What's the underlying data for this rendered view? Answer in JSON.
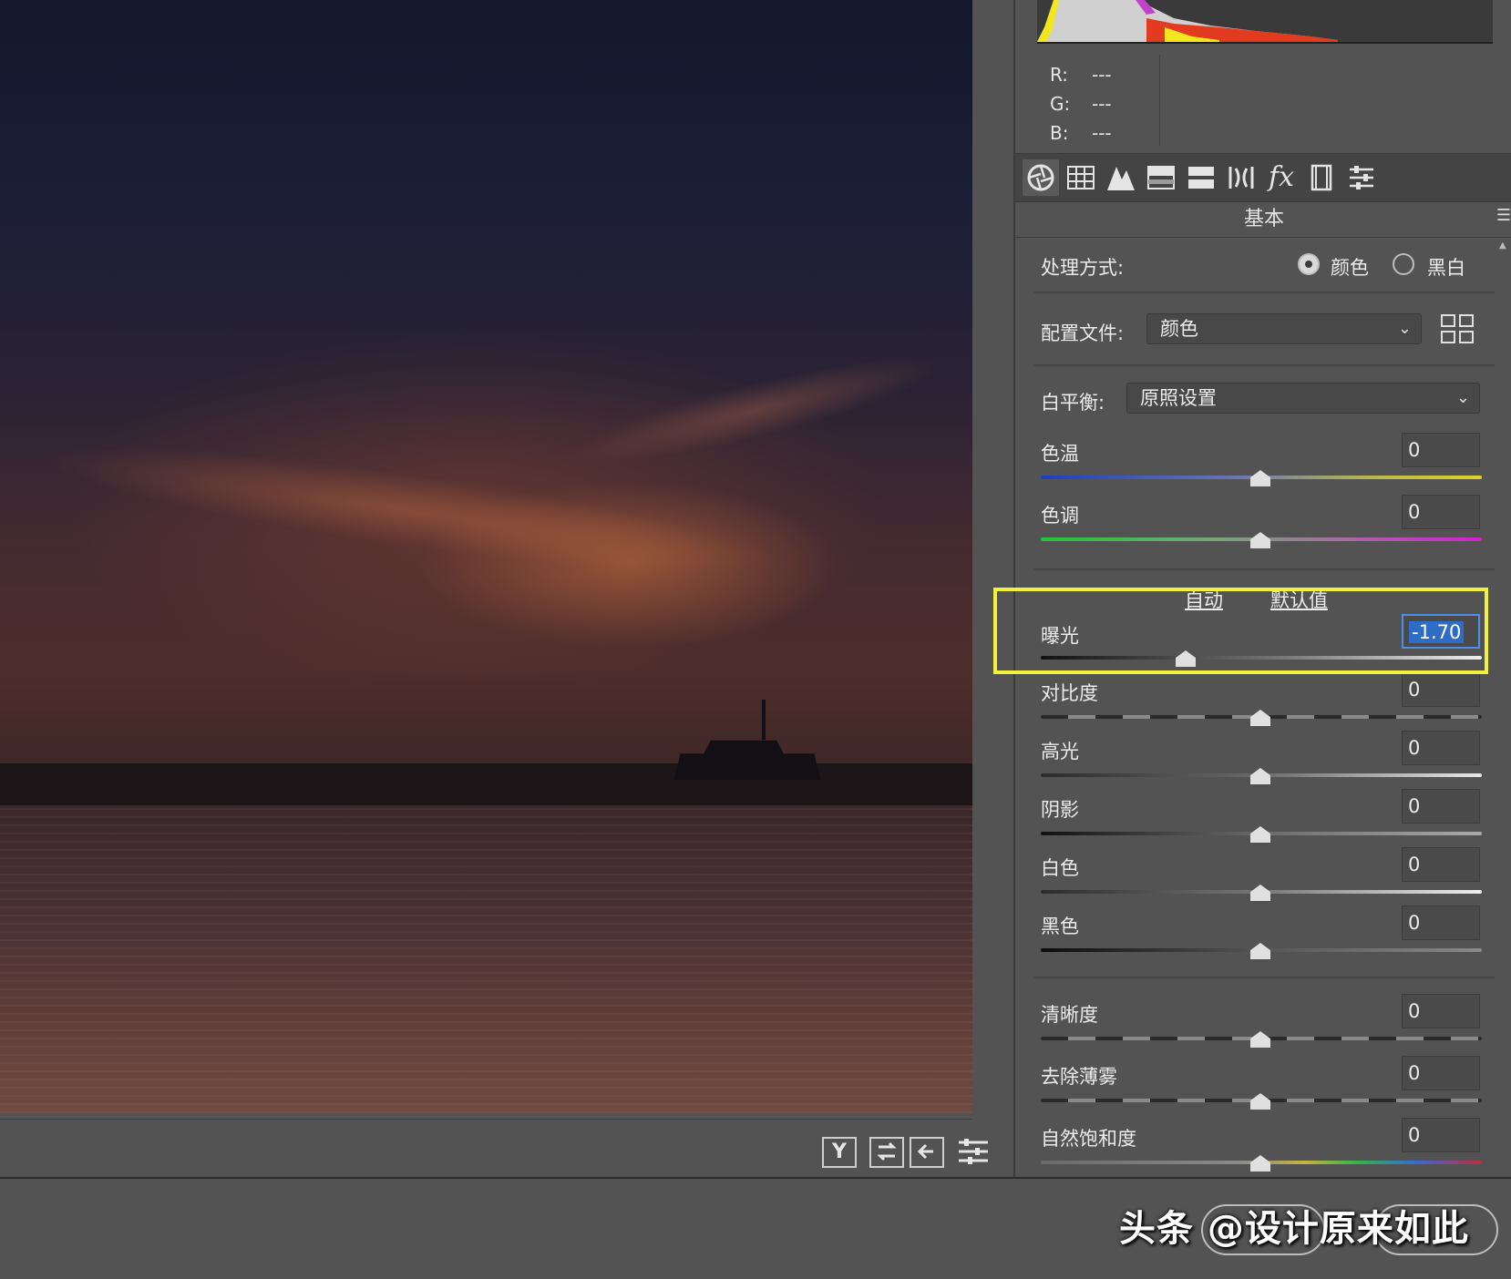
{
  "readout": {
    "r_label": "R:",
    "r_value": "---",
    "g_label": "G:",
    "g_value": "---",
    "b_label": "B:",
    "b_value": "---"
  },
  "tabs": {
    "fx_label": "fx"
  },
  "section_title": "基本",
  "treatment": {
    "label": "处理方式:",
    "color_option": "颜色",
    "bw_option": "黑白",
    "selected": "颜色"
  },
  "profile": {
    "label": "配置文件:",
    "value": "颜色"
  },
  "white_balance": {
    "label": "白平衡:",
    "value": "原照设置"
  },
  "sliders_wb": [
    {
      "label": "色温",
      "value": "0"
    },
    {
      "label": "色调",
      "value": "0"
    }
  ],
  "auto_label": "自动",
  "default_label": "默认值",
  "exposure": {
    "label": "曝光",
    "value": "-1.70"
  },
  "sliders_tone": [
    {
      "label": "对比度",
      "value": "0"
    },
    {
      "label": "高光",
      "value": "0"
    },
    {
      "label": "阴影",
      "value": "0"
    },
    {
      "label": "白色",
      "value": "0"
    },
    {
      "label": "黑色",
      "value": "0"
    }
  ],
  "sliders_presence": [
    {
      "label": "清晰度",
      "value": "0"
    },
    {
      "label": "去除薄雾",
      "value": "0"
    },
    {
      "label": "自然饱和度",
      "value": "0"
    }
  ],
  "view_tools": {
    "y_label": "Y"
  },
  "watermark": "头条 @设计原来如此",
  "colors": {
    "highlight": "#f2f23a",
    "selection": "#2f6cc7",
    "panel": "#535353"
  }
}
